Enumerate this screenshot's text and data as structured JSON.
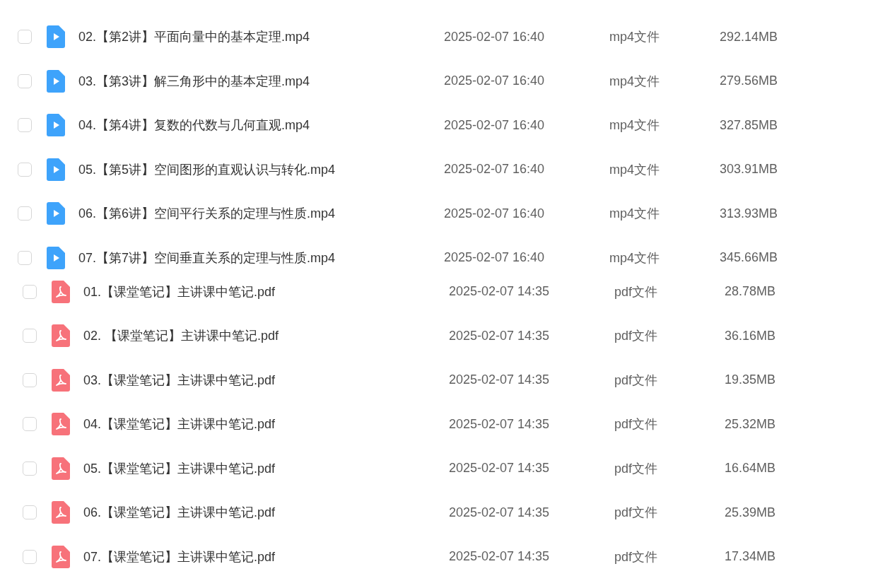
{
  "file_groups": [
    {
      "rows": [
        {
          "kind": "video",
          "checked": false,
          "name": "02.【第2讲】平面向量中的基本定理.mp4",
          "modified": "2025-02-07 16:40",
          "type": "mp4文件",
          "size": "292.14MB"
        },
        {
          "kind": "video",
          "checked": false,
          "name": "03.【第3讲】解三角形中的基本定理.mp4",
          "modified": "2025-02-07 16:40",
          "type": "mp4文件",
          "size": "279.56MB"
        },
        {
          "kind": "video",
          "checked": false,
          "name": "04.【第4讲】复数的代数与几何直观.mp4",
          "modified": "2025-02-07 16:40",
          "type": "mp4文件",
          "size": "327.85MB"
        },
        {
          "kind": "video",
          "checked": false,
          "name": "05.【第5讲】空间图形的直观认识与转化.mp4",
          "modified": "2025-02-07 16:40",
          "type": "mp4文件",
          "size": "303.91MB"
        },
        {
          "kind": "video",
          "checked": false,
          "name": "06.【第6讲】空间平行关系的定理与性质.mp4",
          "modified": "2025-02-07 16:40",
          "type": "mp4文件",
          "size": "313.93MB"
        },
        {
          "kind": "video",
          "checked": false,
          "name": "07.【第7讲】空间垂直关系的定理与性质.mp4",
          "modified": "2025-02-07 16:40",
          "type": "mp4文件",
          "size": "345.66MB"
        }
      ]
    },
    {
      "rows": [
        {
          "kind": "pdf",
          "checked": false,
          "name": "01.【课堂笔记】主讲课中笔记.pdf",
          "modified": "2025-02-07 14:35",
          "type": "pdf文件",
          "size": "28.78MB"
        },
        {
          "kind": "pdf",
          "checked": false,
          "name": "02. 【课堂笔记】主讲课中笔记.pdf",
          "modified": "2025-02-07 14:35",
          "type": "pdf文件",
          "size": "36.16MB"
        },
        {
          "kind": "pdf",
          "checked": false,
          "name": "03.【课堂笔记】主讲课中笔记.pdf",
          "modified": "2025-02-07 14:35",
          "type": "pdf文件",
          "size": "19.35MB"
        },
        {
          "kind": "pdf",
          "checked": false,
          "name": "04.【课堂笔记】主讲课中笔记.pdf",
          "modified": "2025-02-07 14:35",
          "type": "pdf文件",
          "size": "25.32MB"
        },
        {
          "kind": "pdf",
          "checked": false,
          "name": "05.【课堂笔记】主讲课中笔记.pdf",
          "modified": "2025-02-07 14:35",
          "type": "pdf文件",
          "size": "16.64MB"
        },
        {
          "kind": "pdf",
          "checked": false,
          "name": "06.【课堂笔记】主讲课中笔记.pdf",
          "modified": "2025-02-07 14:35",
          "type": "pdf文件",
          "size": "25.39MB"
        },
        {
          "kind": "pdf",
          "checked": false,
          "name": "07.【课堂笔记】主讲课中笔记.pdf",
          "modified": "2025-02-07 14:35",
          "type": "pdf文件",
          "size": "17.34MB"
        }
      ]
    }
  ]
}
